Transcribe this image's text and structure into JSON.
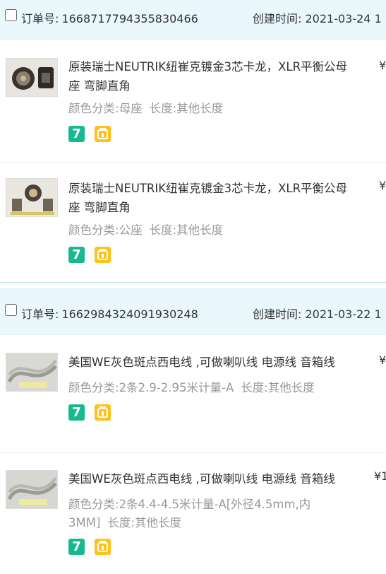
{
  "orders": [
    {
      "order_label": "订单号:",
      "order_no": "1668717794355830466",
      "time_label": "创建时间:",
      "time": "2021-03-24 1",
      "items": [
        {
          "title": "原装瑞士NEUTRIK纽崔克镀金3芯卡龙，XLR平衡公母座 弯脚直角",
          "sku_label": "颜色分类:",
          "sku_value": "母座",
          "len_label": "长度:",
          "len_value": "其他长度",
          "price": "¥"
        },
        {
          "title": "原装瑞士NEUTRIK纽崔克镀金3芯卡龙，XLR平衡公母座 弯脚直角",
          "sku_label": "颜色分类:",
          "sku_value": "公座",
          "len_label": "长度:",
          "len_value": "其他长度",
          "price": "¥"
        }
      ]
    },
    {
      "order_label": "订单号:",
      "order_no": "1662984324091930248",
      "time_label": "创建时间:",
      "time": "2021-03-22 1",
      "items": [
        {
          "title": "美国WE灰色斑点西电线 ,可做喇叭线 电源线 音箱线",
          "sku_label": "颜色分类:",
          "sku_value": "2条2.9-2.95米计量-A",
          "len_label": "长度:",
          "len_value": "其他长度",
          "price": "¥"
        },
        {
          "title": "美国WE灰色斑点西电线 ,可做喇叭线 电源线 音箱线",
          "sku_label": "颜色分类:",
          "sku_value": "2条4.4-4.5米计量-A[外径4.5mm,内3MM]",
          "len_label": "长度:",
          "len_value": "其他长度",
          "price": "¥1"
        }
      ]
    }
  ],
  "badges": {
    "seven_text": "7"
  },
  "colors": {
    "header_bg": "#eaf8fe",
    "badge_seven": "#19b98f",
    "badge_guard": "#ffc21a",
    "sku_text": "#999999"
  }
}
